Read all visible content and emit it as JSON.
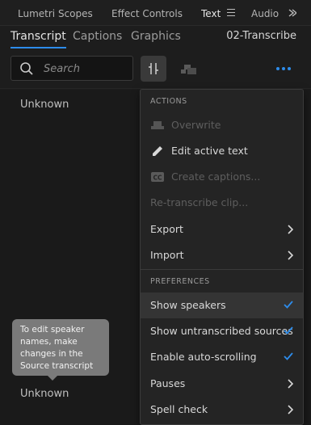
{
  "panel_tabs": {
    "lumetri": "Lumetri Scopes",
    "effect_controls": "Effect Controls",
    "text": "Text",
    "audio": "Audio C"
  },
  "subtabs": {
    "transcript": "Transcript",
    "captions": "Captions",
    "graphics": "Graphics"
  },
  "sequence_name": "02-Transcribe",
  "search": {
    "placeholder": "Search",
    "value": ""
  },
  "transcript": {
    "speaker_1": "Unknown",
    "speaker_2": "Unknown",
    "tooltip": "To edit speaker names, make changes in the Source transcript"
  },
  "menu": {
    "actions_header": "ACTIONS",
    "overwrite": "Overwrite",
    "edit_active_text": "Edit active text",
    "create_captions": "Create captions...",
    "retranscribe": "Re-transcribe clip...",
    "export": "Export",
    "import": "Import",
    "preferences_header": "PREFERENCES",
    "show_speakers": "Show speakers",
    "show_untranscribed": "Show untranscribed sources",
    "enable_autoscroll": "Enable auto-scrolling",
    "pauses": "Pauses",
    "spell_check": "Spell check"
  },
  "colors": {
    "accent_blue": "#2d8ceb",
    "panel_bg": "#1d1d1d",
    "menu_bg": "#242424"
  }
}
